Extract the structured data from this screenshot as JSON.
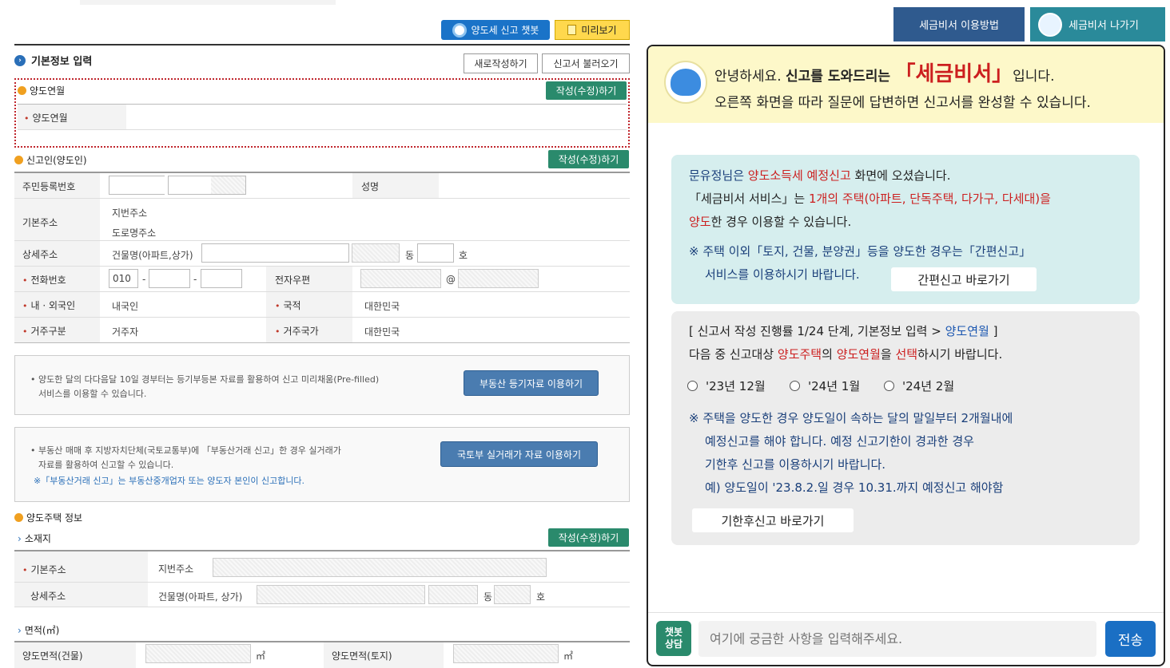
{
  "top": {
    "chatbot_btn": "양도세 신고 챗봇",
    "preview_btn": "미리보기"
  },
  "basic": {
    "title": "기본정보 입력",
    "new_btn": "새로작성하기",
    "load_btn": "신고서 불러오기",
    "edit_label": "작성(수정)하기"
  },
  "transfer_month": {
    "section": "양도연월",
    "field": "양도연월"
  },
  "reporter": {
    "section": "신고인(양도인)",
    "rrn": "주민등록번호",
    "name": "성명",
    "base_addr": "기본주소",
    "jibun": "지번주소",
    "road": "도로명주소",
    "detail_addr": "상세주소",
    "building": "건물명(아파트,상가)",
    "dong": "동",
    "ho": "호",
    "phone": "전화번호",
    "phone_prefix": "010",
    "dash": "-",
    "email": "전자우편",
    "at": "@",
    "nationality": "내 · 외국인",
    "nationality_val": "내국인",
    "country": "국적",
    "country_val": "대한민국",
    "residence": "거주구분",
    "residence_val": "거주자",
    "res_country": "거주국가",
    "res_country_val": "대한민국"
  },
  "info1": {
    "text1": "양도한 달의 다다음달 10일 경부터는 등기부등본 자료를 활용하여 신고 미리채움(Pre-filled)",
    "text2": "서비스를 이용할 수 있습니다.",
    "btn": "부동산 등기자료 이용하기"
  },
  "info2": {
    "text1": "부동산 매매 후 지방자치단체(국토교통부)에 「부동산거래 신고」한 경우 실거래가",
    "text2": "자료를 활용하여 신고할 수 있습니다.",
    "note": "※「부동산거래 신고」는 부동산중개업자 또는 양도자 본인이 신고합니다.",
    "btn": "국토부 실거래가 자료 이용하기"
  },
  "house": {
    "section": "양도주택 정보",
    "location": "소재지",
    "base_addr": "기본주소",
    "jibun": "지번주소",
    "detail_addr": "상세주소",
    "building": "건물명(아파트, 상가)",
    "dong": "동",
    "ho": "호",
    "area": "면적(㎡)",
    "area_bldg": "양도면적(건물)",
    "area_land": "양도면적(토지)",
    "unit": "㎡"
  },
  "header_right": {
    "howto": "세금비서 이용방법",
    "exit": "세금비서 나가기"
  },
  "chat": {
    "greet1a": "안녕하세요. ",
    "greet1b": "신고를 도와드리는",
    "greet1c": "「세금비서」",
    "greet1d": "입니다.",
    "greet2": "오른쪽 화면을 따라 질문에 답변하면 신고서를 완성할 수 있습니다.",
    "b1_l1a": "문유정님은 ",
    "b1_l1b": "양도소득세 예정신고",
    "b1_l1c": " 화면에 오셨습니다.",
    "b1_l2a": "「세금비서 서비스」는 ",
    "b1_l2b": "1개의 주택(아파트, 단독주택, 다가구, 다세대)을",
    "b1_l3a": "양도",
    "b1_l3b": "한 경우 이용할 수 있습니다.",
    "b1_n1": "※ 주택 이외「토지, 건물, 분양권」등을 양도한 경우는「간편신고」",
    "b1_n2": "서비스를 이용하시기 바랍니다.",
    "b1_btn": "간편신고 바로가기",
    "b2_l1a": "[ 신고서 작성 진행률 1/24 단계, 기본정보 입력 > ",
    "b2_l1b": "양도연월",
    "b2_l1c": " ]",
    "b2_l2a": "다음 중 신고대상 ",
    "b2_l2b": "양도주택",
    "b2_l2c": "의 ",
    "b2_l2d": "양도연월",
    "b2_l2e": "을 ",
    "b2_l2f": "선택",
    "b2_l2g": "하시기 바랍니다.",
    "opt1": "'23년 12월",
    "opt2": "'24년 1월",
    "opt3": "'24년 2월",
    "n1": "※ 주택을 양도한 경우 양도일이 속하는 달의 말일부터 2개월내에",
    "n2": "예정신고를 해야 합니다. 예정 신고기한이 경과한 경우",
    "n3": "기한후 신고를 이용하시기 바랍니다.",
    "n4": "예) 양도일이 '23.8.2.일 경우 10.31.까지 예정신고 해야함",
    "b2_btn": "기한후신고 바로가기",
    "consult1": "챗봇",
    "consult2": "상담",
    "placeholder": "여기에 궁금한 사항을 입력해주세요.",
    "send": "전송"
  },
  "colors": {
    "accent_red": "#cc1f1f",
    "brand_blue": "#1a73c8",
    "green": "#2a8a6c",
    "navy": "#2f5a8e"
  }
}
